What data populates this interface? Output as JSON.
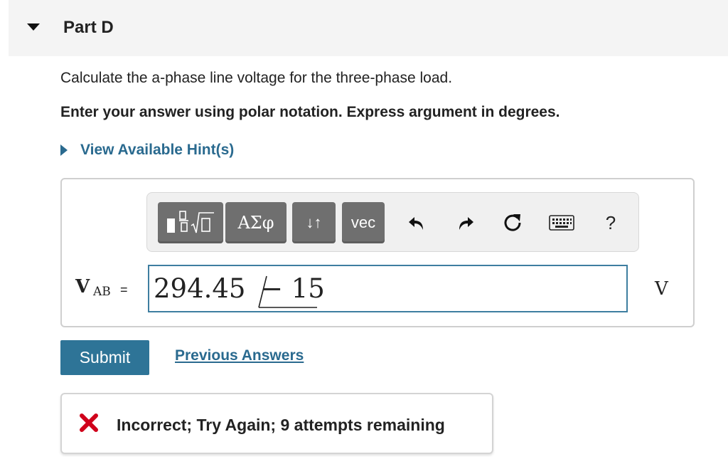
{
  "part": {
    "title": "Part D"
  },
  "question": {
    "text": "Calculate the a-phase line voltage for the three-phase load.",
    "instruction": "Enter your answer using polar notation. Express argument in degrees."
  },
  "hint": {
    "label": "View Available Hint(s)"
  },
  "toolbar": {
    "templates_icon": "templates-icon",
    "greek_label": "ΑΣφ",
    "arrows_label": "↓↑",
    "vec_label": "vec",
    "undo_icon": "undo-icon",
    "redo_icon": "redo-icon",
    "reset_icon": "reset-icon",
    "keyboard_icon": "keyboard-icon",
    "help_label": "?"
  },
  "answer": {
    "variable": "V",
    "subscript": "AB",
    "equals": "=",
    "magnitude": "294.45",
    "angle": "− 15",
    "unit": "V"
  },
  "actions": {
    "submit_label": "Submit",
    "previous_label": "Previous Answers"
  },
  "feedback": {
    "status_icon": "incorrect-x-icon",
    "status_color": "#d0021b",
    "message": "Incorrect; Try Again; 9 attempts remaining"
  }
}
